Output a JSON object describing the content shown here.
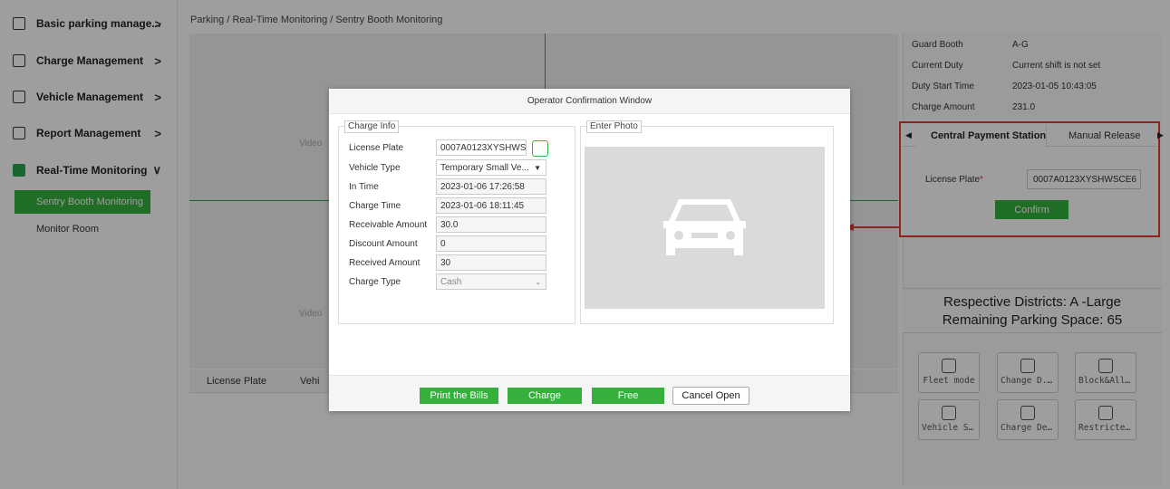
{
  "sidebar": {
    "items": [
      {
        "label": "Basic parking manage..."
      },
      {
        "label": "Charge Management"
      },
      {
        "label": "Vehicle Management"
      },
      {
        "label": "Report Management"
      },
      {
        "label": "Real-Time Monitoring"
      }
    ],
    "sub_items": [
      {
        "label": "Sentry Booth Monitoring"
      },
      {
        "label": "Monitor Room"
      }
    ]
  },
  "breadcrumb": "Parking / Real-Time Monitoring / Sentry Booth Monitoring",
  "video_label": "Video",
  "list_headers": [
    "License Plate",
    "Vehi"
  ],
  "booth_info": {
    "rows": [
      {
        "label": "Guard Booth",
        "value": "A-G"
      },
      {
        "label": "Current Duty",
        "value": "Current shift is not set"
      },
      {
        "label": "Duty Start Time",
        "value": "2023-01-05 10:43:05"
      },
      {
        "label": "Charge Amount",
        "value": "231.0"
      }
    ]
  },
  "right_tabs": [
    "Central Payment Station",
    "Manual Release"
  ],
  "central_payment": {
    "license_label": "License Plate",
    "license_value": "0007A0123XYSHWSCE6",
    "confirm_label": "Confirm"
  },
  "districts": {
    "line1": "Respective Districts: A -Large",
    "line2": "Remaining Parking Space: 65"
  },
  "function_buttons": [
    {
      "label": "Fleet mode",
      "icon": "fleet-icon"
    },
    {
      "label": "Change D...",
      "icon": "change-icon"
    },
    {
      "label": "Block&Allo...",
      "icon": "block-allow-icon"
    },
    {
      "label": "Vehicle Se...",
      "icon": "vehicle-search-icon"
    },
    {
      "label": "Charge De...",
      "icon": "charge-detail-icon"
    },
    {
      "label": "Restricted...",
      "icon": "restricted-icon"
    }
  ],
  "modal": {
    "title": "Operator Confirmation Window",
    "charge_info_legend": "Charge Info",
    "enter_photo_legend": "Enter Photo",
    "fields": [
      {
        "label": "License Plate",
        "value": "0007A0123XYSHWS"
      },
      {
        "label": "Vehicle Type",
        "value": "Temporary Small Ve..."
      },
      {
        "label": "In Time",
        "value": "2023-01-06 17:26:58"
      },
      {
        "label": "Charge Time",
        "value": "2023-01-06 18:11:45"
      },
      {
        "label": "Receivable Amount",
        "value": "30.0"
      },
      {
        "label": "Discount Amount",
        "value": "0"
      },
      {
        "label": "Received Amount",
        "value": "30"
      },
      {
        "label": "Charge Type",
        "value": "Cash"
      }
    ],
    "buttons": {
      "print": "Print the Bills",
      "charge": "Charge",
      "free": "Free",
      "cancel": "Cancel Open"
    }
  },
  "colors": {
    "accent_green": "#35b03c",
    "highlight_red": "#e53935"
  }
}
